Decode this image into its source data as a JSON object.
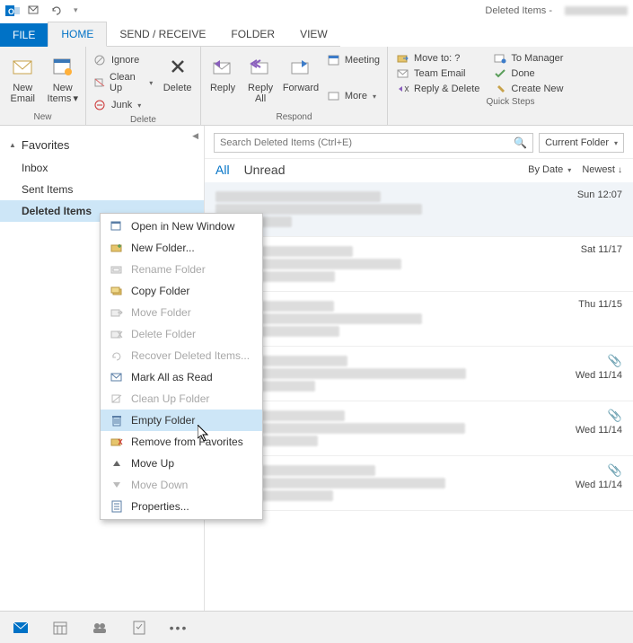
{
  "titlebar": {
    "title": "Deleted Items -"
  },
  "tabs": {
    "file": "FILE",
    "home": "HOME",
    "sendreceive": "SEND / RECEIVE",
    "folder": "FOLDER",
    "view": "VIEW"
  },
  "ribbon": {
    "new": {
      "label": "New",
      "new_email": "New\nEmail",
      "new_items": "New\nItems"
    },
    "delete": {
      "label": "Delete",
      "ignore": "Ignore",
      "cleanup": "Clean Up",
      "junk": "Junk",
      "delete_btn": "Delete"
    },
    "respond": {
      "label": "Respond",
      "reply": "Reply",
      "reply_all": "Reply\nAll",
      "forward": "Forward",
      "meeting": "Meeting",
      "more": "More"
    },
    "quicksteps": {
      "label": "Quick Steps",
      "moveto": "Move to: ?",
      "team_email": "Team Email",
      "reply_delete": "Reply & Delete",
      "to_manager": "To Manager",
      "done": "Done",
      "create_new": "Create New"
    }
  },
  "sidebar": {
    "favorites": "Favorites",
    "folders": [
      "Inbox",
      "Sent Items",
      "Deleted Items"
    ]
  },
  "search": {
    "placeholder": "Search Deleted Items (Ctrl+E)",
    "scope": "Current Folder"
  },
  "filters": {
    "all": "All",
    "unread": "Unread",
    "by_date": "By Date",
    "newest": "Newest"
  },
  "messages": [
    {
      "date": "Sun 12:07",
      "attachment": false,
      "selected": true
    },
    {
      "date": "Sat 11/17",
      "attachment": false
    },
    {
      "date": "Thu 11/15",
      "attachment": false
    },
    {
      "date": "Wed 11/14",
      "attachment": true
    },
    {
      "date": "Wed 11/14",
      "attachment": true
    },
    {
      "date": "Wed 11/14",
      "attachment": true
    }
  ],
  "context_menu": [
    {
      "label": "Open in New Window",
      "icon": "window-icon",
      "disabled": false
    },
    {
      "label": "New Folder...",
      "icon": "folder-new-icon",
      "disabled": false
    },
    {
      "label": "Rename Folder",
      "icon": "rename-icon",
      "disabled": true
    },
    {
      "label": "Copy Folder",
      "icon": "folder-copy-icon",
      "disabled": false
    },
    {
      "label": "Move Folder",
      "icon": "folder-move-icon",
      "disabled": true
    },
    {
      "label": "Delete Folder",
      "icon": "folder-delete-icon",
      "disabled": true
    },
    {
      "label": "Recover Deleted Items...",
      "icon": "recover-icon",
      "disabled": true
    },
    {
      "label": "Mark All as Read",
      "icon": "mark-read-icon",
      "disabled": false
    },
    {
      "label": "Clean Up Folder",
      "icon": "cleanup-icon",
      "disabled": true
    },
    {
      "label": "Empty Folder",
      "icon": "empty-icon",
      "disabled": false,
      "hover": true
    },
    {
      "label": "Remove from Favorites",
      "icon": "remove-fav-icon",
      "disabled": false
    },
    {
      "label": "Move Up",
      "icon": "move-up-icon",
      "disabled": false
    },
    {
      "label": "Move Down",
      "icon": "move-down-icon",
      "disabled": true
    },
    {
      "label": "Properties...",
      "icon": "properties-icon",
      "disabled": false
    }
  ]
}
